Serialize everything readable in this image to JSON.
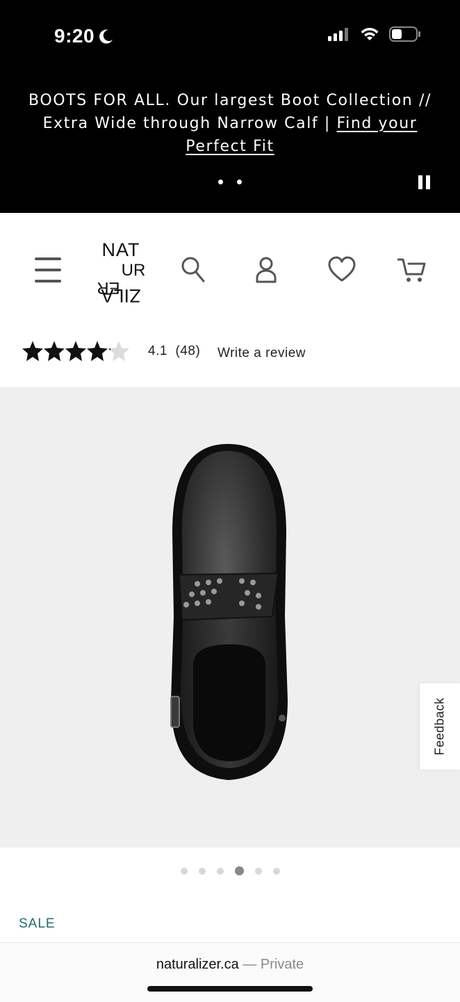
{
  "status_bar": {
    "time": "9:20"
  },
  "promo": {
    "text": "BOOTS FOR ALL. Our largest Boot Collection // Extra Wide through Narrow Calf | ",
    "link": "Find your Perfect Fit"
  },
  "header": {
    "logo_line1": "NAT",
    "logo_line2": "UR",
    "logo_line3": "AL",
    "logo_line4": "IZ",
    "logo_line5": "ER"
  },
  "rating": {
    "value": "4.1",
    "count": "(48)",
    "stars": 4.1,
    "write_review": "Write a review"
  },
  "gallery": {
    "total_images": 6,
    "active_index": 3
  },
  "feedback_label": "Feedback",
  "sale_label": "SALE",
  "browser": {
    "domain": "naturalizer.ca",
    "separator": " — ",
    "mode": "Private"
  },
  "colors": {
    "sale": "#1a6e72",
    "banner_bg": "#000000",
    "image_bg": "#efefef"
  }
}
